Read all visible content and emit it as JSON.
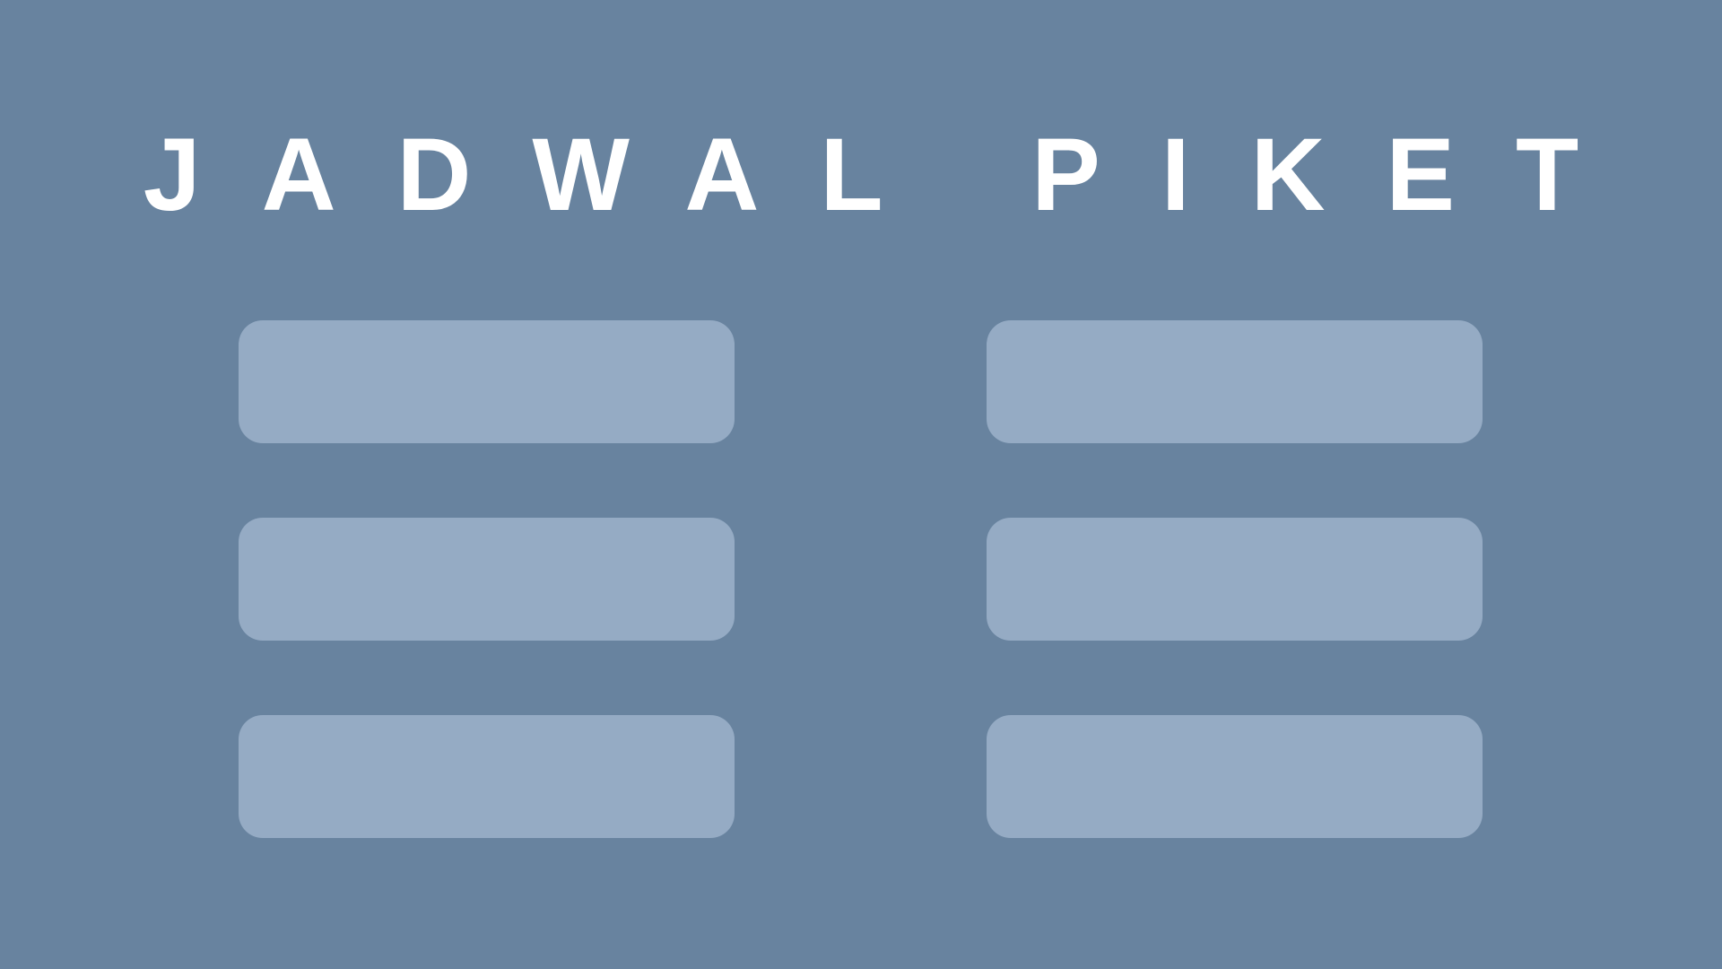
{
  "title": "JADWAL PIKET",
  "colors": {
    "background": "#68839f",
    "slot_fill": "#95abc4",
    "title_text": "#ffffff"
  },
  "slots": [
    {
      "column": 1,
      "row": 1,
      "text": ""
    },
    {
      "column": 2,
      "row": 1,
      "text": ""
    },
    {
      "column": 1,
      "row": 2,
      "text": ""
    },
    {
      "column": 2,
      "row": 2,
      "text": ""
    },
    {
      "column": 1,
      "row": 3,
      "text": ""
    },
    {
      "column": 2,
      "row": 3,
      "text": ""
    }
  ]
}
